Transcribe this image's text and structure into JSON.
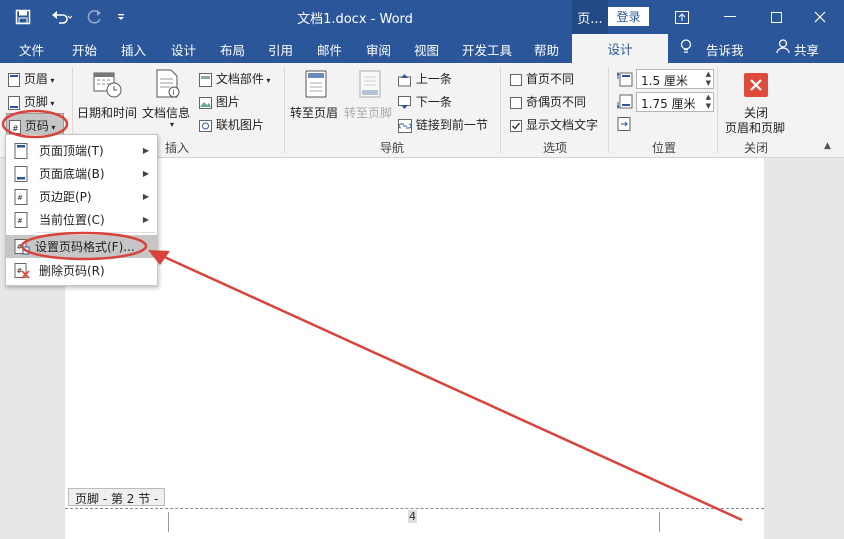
{
  "title": {
    "doc_title": "文档1.docx  -  Word",
    "context_tab": "页...",
    "login": "登录"
  },
  "menu": {
    "items": [
      "文件",
      "开始",
      "插入",
      "设计",
      "布局",
      "引用",
      "邮件",
      "审阅",
      "视图",
      "开发工具",
      "帮助"
    ],
    "active": "设计",
    "tell_me": "告诉我",
    "share": "共享"
  },
  "ribbon": {
    "header": "页眉",
    "footer": "页脚",
    "page_number": "页码",
    "date_time": "日期和时间",
    "doc_info": "文档信息",
    "doc_parts": "文档部件",
    "picture": "图片",
    "online_picture": "联机图片",
    "group_insert": "插入",
    "goto_header": "转至页眉",
    "goto_footer": "转至页脚",
    "prev": "上一条",
    "next": "下一条",
    "link_prev": "链接到前一节",
    "group_nav": "导航",
    "first_page_diff": "首页不同",
    "odd_even_diff": "奇偶页不同",
    "show_doc_text": "显示文档文字",
    "group_options": "选项",
    "header_pos": "1.5 厘米",
    "footer_pos": "1.75 厘米",
    "group_position": "位置",
    "close_line1": "关闭",
    "close_line2": "页眉和页脚",
    "group_close": "关闭"
  },
  "dropdown": {
    "items": [
      {
        "label": "页面顶端(T)",
        "submenu": true
      },
      {
        "label": "页面底端(B)",
        "submenu": true
      },
      {
        "label": "页边距(P)",
        "submenu": true
      },
      {
        "label": "当前位置(C)",
        "submenu": true
      },
      {
        "label": "设置页码格式(F)...",
        "submenu": false
      },
      {
        "label": "删除页码(R)",
        "submenu": false
      }
    ]
  },
  "document": {
    "footer_label": "页脚 - 第 2 节 -",
    "page_num": "4"
  },
  "colors": {
    "brand": "#2b579a",
    "annotation": "#d9433b"
  }
}
